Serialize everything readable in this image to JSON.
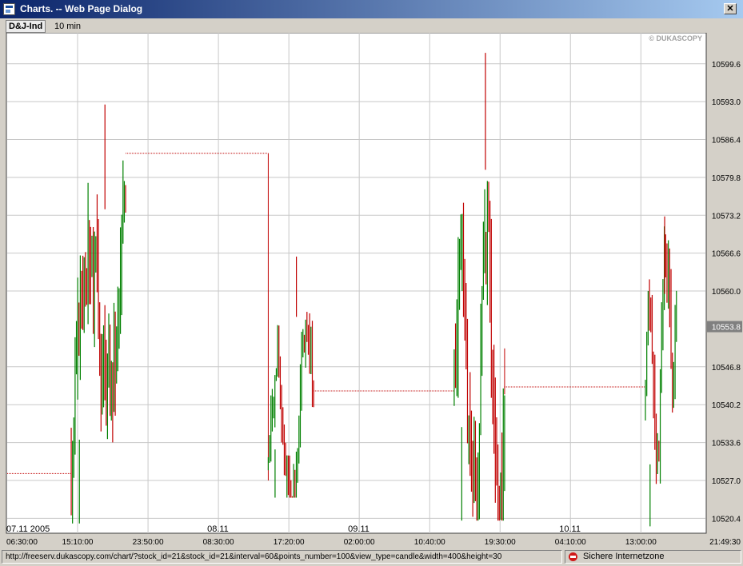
{
  "window": {
    "title": "Charts. -- Web Page Dialog",
    "close_glyph": "✕"
  },
  "header": {
    "symbol": "D&J-Ind",
    "interval": "10 min"
  },
  "watermark": "© DUKASCOPY",
  "status": {
    "url": "http://freeserv.dukascopy.com/chart/?stock_id=21&stock_id=21&interval=60&points_number=100&view_type=candle&width=400&height=30",
    "zone": "Sichere Internetzone"
  },
  "colors": {
    "up": "#008000",
    "down": "#c00000",
    "grid": "#c8c8c8",
    "last_price_bg": "#808080",
    "last_price_text": "#ffffff"
  },
  "chart_data": {
    "type": "bar",
    "description_style": "high-low price bars with gap connector lines",
    "y_ticks": [
      "10599.6",
      "10593.0",
      "10586.4",
      "10579.8",
      "10573.2",
      "10566.6",
      "10560.0",
      "10546.8",
      "10540.2",
      "10533.6",
      "10527.0",
      "10520.4"
    ],
    "ylim": [
      10517.8,
      10605.0
    ],
    "last_price": "10553.8",
    "last_price_value": 10553.8,
    "x_ticks": [
      "06:30:00",
      "15:10:00",
      "23:50:00",
      "08:30:00",
      "17:20:00",
      "02:00:00",
      "10:40:00",
      "19:30:00",
      "04:10:00",
      "13:00:00",
      "21:49:30"
    ],
    "x_tick_fractions": [
      0.0,
      0.1008,
      0.2017,
      0.3025,
      0.4034,
      0.5042,
      0.6051,
      0.7059,
      0.8067,
      0.9076,
      1.0
    ],
    "date_labels": [
      {
        "text": "07.11 2005",
        "at": 0.0
      },
      {
        "text": "08.11",
        "at": 0.3025
      },
      {
        "text": "09.11",
        "at": 0.5042
      },
      {
        "text": "10.11",
        "at": 0.8067
      }
    ],
    "flat_segments": [
      {
        "from": 0.0,
        "to": 0.0917,
        "price": 10528.2
      },
      {
        "from": 0.1696,
        "to": 0.3739,
        "price": 10584.0
      },
      {
        "from": 0.4389,
        "to": 0.6402,
        "price": 10542.6
      },
      {
        "from": 0.7124,
        "to": 0.9141,
        "price": 10543.3
      }
    ],
    "vertical_steps": [
      {
        "at": 0.3739,
        "from": 10584.0,
        "to": 10527.0
      },
      {
        "at": 0.7124,
        "from": 10550.0,
        "to": 10542.0
      }
    ],
    "bar_groups": [
      {
        "start": 0.0917,
        "end": 0.1696,
        "low": 10519.5,
        "high": 10592.5,
        "open": 10528.0,
        "close": 10584.0,
        "seed": 3
      },
      {
        "start": 0.3739,
        "end": 0.4389,
        "low": 10524.0,
        "high": 10566.0,
        "open": 10530.0,
        "close": 10541.0,
        "seed": 7
      },
      {
        "start": 0.6402,
        "end": 0.7124,
        "low": 10520.0,
        "high": 10601.5,
        "open": 10541.0,
        "close": 10545.0,
        "seed": 11
      },
      {
        "start": 0.9141,
        "end": 0.9585,
        "low": 10519.0,
        "high": 10573.0,
        "open": 10540.0,
        "close": 10561.0,
        "seed": 17
      }
    ]
  }
}
